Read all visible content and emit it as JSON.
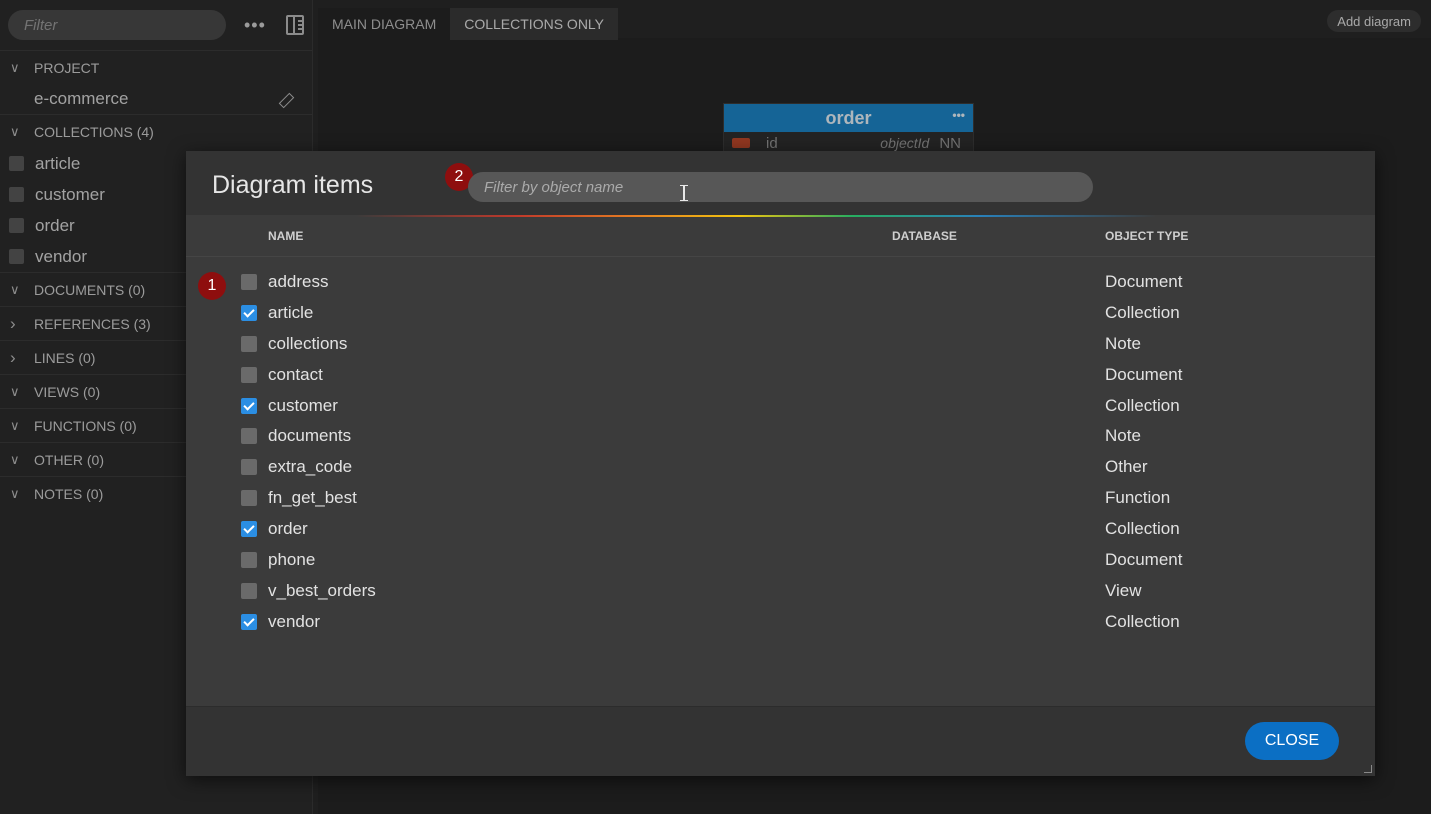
{
  "sidebar": {
    "filter_placeholder": "Filter",
    "project": {
      "header": "PROJECT",
      "name": "e-commerce"
    },
    "collections": {
      "header": "COLLECTIONS (4)",
      "items": [
        "article",
        "customer",
        "order",
        "vendor"
      ]
    },
    "sections": [
      {
        "label": "DOCUMENTS (0)",
        "expanded": true
      },
      {
        "label": "REFERENCES (3)",
        "expanded": false
      },
      {
        "label": "LINES (0)",
        "expanded": false
      },
      {
        "label": "VIEWS (0)",
        "expanded": true
      },
      {
        "label": "FUNCTIONS (0)",
        "expanded": true
      },
      {
        "label": "OTHER (0)",
        "expanded": true
      },
      {
        "label": "NOTES (0)",
        "expanded": true
      }
    ]
  },
  "tabs": [
    {
      "label": "MAIN DIAGRAM",
      "active": false
    },
    {
      "label": "COLLECTIONS ONLY",
      "active": true
    }
  ],
  "add_diagram_label": "Add diagram",
  "entity": {
    "title": "order",
    "field_name": "id",
    "field_type": "objectId",
    "field_flag": "NN"
  },
  "modal": {
    "title": "Diagram items",
    "filter_placeholder": "Filter by object name",
    "badge_1": "1",
    "badge_2": "2",
    "columns": {
      "name": "NAME",
      "database": "DATABASE",
      "type": "OBJECT TYPE"
    },
    "rows": [
      {
        "name": "address",
        "database": "",
        "type": "Document",
        "checked": false
      },
      {
        "name": "article",
        "database": "",
        "type": "Collection",
        "checked": true
      },
      {
        "name": "collections",
        "database": "",
        "type": "Note",
        "checked": false
      },
      {
        "name": "contact",
        "database": "",
        "type": "Document",
        "checked": false
      },
      {
        "name": "customer",
        "database": "",
        "type": "Collection",
        "checked": true
      },
      {
        "name": "documents",
        "database": "",
        "type": "Note",
        "checked": false
      },
      {
        "name": "extra_code",
        "database": "",
        "type": "Other",
        "checked": false
      },
      {
        "name": "fn_get_best",
        "database": "",
        "type": "Function",
        "checked": false
      },
      {
        "name": "order",
        "database": "",
        "type": "Collection",
        "checked": true
      },
      {
        "name": "phone",
        "database": "",
        "type": "Document",
        "checked": false
      },
      {
        "name": "v_best_orders",
        "database": "",
        "type": "View",
        "checked": false
      },
      {
        "name": "vendor",
        "database": "",
        "type": "Collection",
        "checked": true
      }
    ],
    "close_label": "CLOSE"
  },
  "colors": {
    "accent": "#2b8ee3",
    "entity_header": "#1c86c8",
    "badge": "#8e0e0e",
    "close_button": "#0b6fc4"
  }
}
